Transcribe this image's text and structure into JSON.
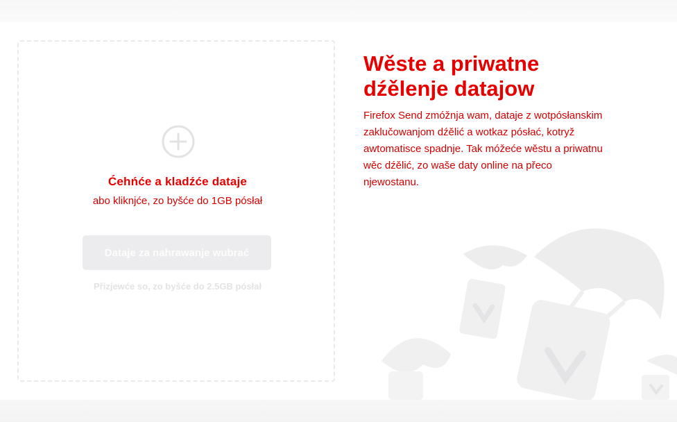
{
  "upload": {
    "drag_title": "Ćehńće a kladźće dataje",
    "drag_subtitle": "abo kliknjće, zo byšće do 1GB pósłał",
    "pick_button": "Dataje za nahrawanje wubrać",
    "size_hint": "Přizjewće so, zo byšće do 2.5GB pósłał"
  },
  "info": {
    "headline": "Wěste a priwatne dźělenje datajow",
    "description": "Firefox Send zmóžnja wam, dataje z wotpósłanskim zaklučowanjom dźělić a wotkaz pósłać, kotryž awtomatisce spadnje. Tak móžeće wěstu a priwatnu wěc dźělić, zo waše daty online na přeco njewostanu."
  },
  "icons": {
    "plus": "plus-circle-icon",
    "illustration": "parachute-boxes-illustration"
  },
  "colors": {
    "accent": "#e60000",
    "button_bg": "#ececee",
    "dashed_border": "#e9e9ec"
  }
}
